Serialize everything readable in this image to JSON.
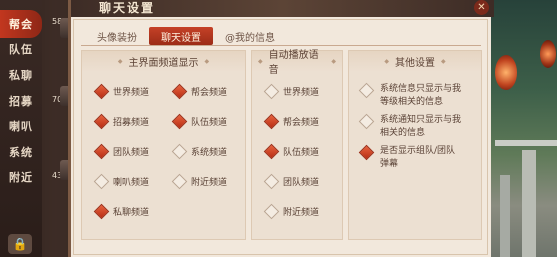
{
  "sidebar": {
    "items": [
      {
        "label": "帮会",
        "active": true
      },
      {
        "label": "队伍",
        "active": false
      },
      {
        "label": "私聊",
        "active": false
      },
      {
        "label": "招募",
        "active": false
      },
      {
        "label": "喇叭",
        "active": false
      },
      {
        "label": "系统",
        "active": false
      },
      {
        "label": "附近",
        "active": false
      }
    ]
  },
  "chat_strip": {
    "counts": [
      "58",
      "70",
      "43"
    ]
  },
  "panel": {
    "title": "聊天设置",
    "close_icon": "close-icon"
  },
  "tabs": [
    {
      "label": "头像装扮",
      "active": false
    },
    {
      "label": "聊天设置",
      "active": true
    },
    {
      "label": "@我的信息",
      "active": false
    }
  ],
  "main_channels": {
    "title": "主界面频道显示",
    "items": [
      {
        "label": "世界频道",
        "checked": true
      },
      {
        "label": "帮会频道",
        "checked": true
      },
      {
        "label": "招募频道",
        "checked": true
      },
      {
        "label": "队伍频道",
        "checked": true
      },
      {
        "label": "团队频道",
        "checked": true
      },
      {
        "label": "系统频道",
        "checked": false
      },
      {
        "label": "喇叭频道",
        "checked": false
      },
      {
        "label": "附近频道",
        "checked": false
      },
      {
        "label": "私聊频道",
        "checked": true
      }
    ]
  },
  "auto_voice": {
    "title": "自动播放语音",
    "items": [
      {
        "label": "世界频道",
        "checked": false
      },
      {
        "label": "帮会频道",
        "checked": true
      },
      {
        "label": "队伍频道",
        "checked": true
      },
      {
        "label": "团队频道",
        "checked": false
      },
      {
        "label": "附近频道",
        "checked": false
      }
    ]
  },
  "other": {
    "title": "其他设置",
    "items": [
      {
        "line1": "系统信息只显示与我",
        "line2": "等级相关的信息",
        "checked": false
      },
      {
        "line1": "系统通知只显示与我",
        "line2": "相关的信息",
        "checked": false
      },
      {
        "line1": "是否显示组队/团队",
        "line2": "弹幕",
        "checked": true
      }
    ]
  },
  "colors": {
    "accent": "#c2371f",
    "panel_bg": "#f2e8dc"
  }
}
